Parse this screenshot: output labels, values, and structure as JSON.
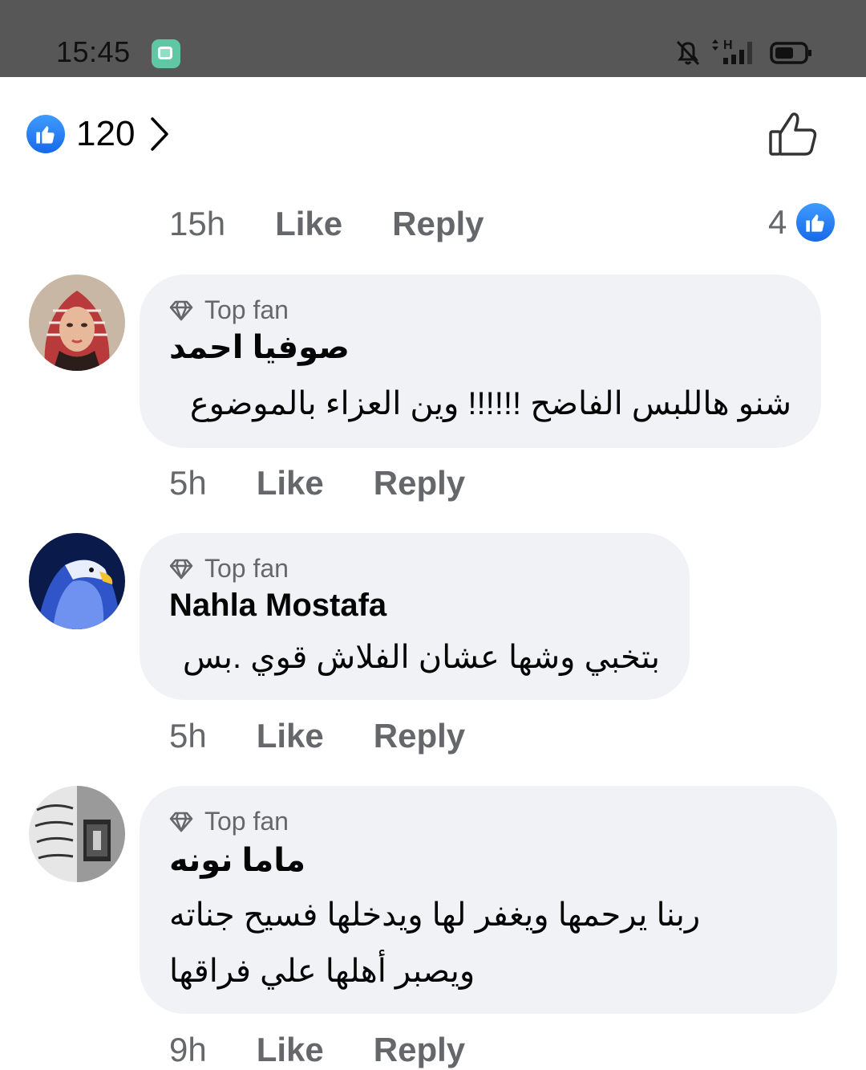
{
  "status_bar": {
    "time": "15:45",
    "network_label": "H",
    "icons": [
      "app-notification-icon",
      "bell-off-icon",
      "network-h-icon",
      "signal-icon",
      "battery-icon"
    ]
  },
  "reactions": {
    "total_count": "120",
    "icons": [
      "like-reaction-icon",
      "chevron-right-icon",
      "like-outline-icon"
    ]
  },
  "parent_actions": {
    "time": "15h",
    "like_label": "Like",
    "reply_label": "Reply",
    "reaction_count": "4"
  },
  "comments": [
    {
      "badge": "Top fan",
      "author": "صوفيا احمد",
      "lines": [
        "شنو هاللبس الفاضح !!!!!! وين العزاء بالموضوع"
      ],
      "time": "5h",
      "like_label": "Like",
      "reply_label": "Reply"
    },
    {
      "badge": "Top fan",
      "author": "Nahla Mostafa",
      "lines": [
        "بتخبي وشها عشان الفلاش قوي .بس"
      ],
      "time": "5h",
      "like_label": "Like",
      "reply_label": "Reply"
    },
    {
      "badge": "Top fan",
      "author": "ماما نونه",
      "lines": [
        "ربنا يرحمها ويغفر لها ويدخلها فسيح جناته",
        "ويصبر أهلها علي فراقها"
      ],
      "time": "9h",
      "like_label": "Like",
      "reply_label": "Reply"
    }
  ],
  "colors": {
    "status_bar": "#575757",
    "bubble": "#f0f2f5",
    "secondary_text": "#65676b",
    "like_blue": "#1877f2"
  }
}
